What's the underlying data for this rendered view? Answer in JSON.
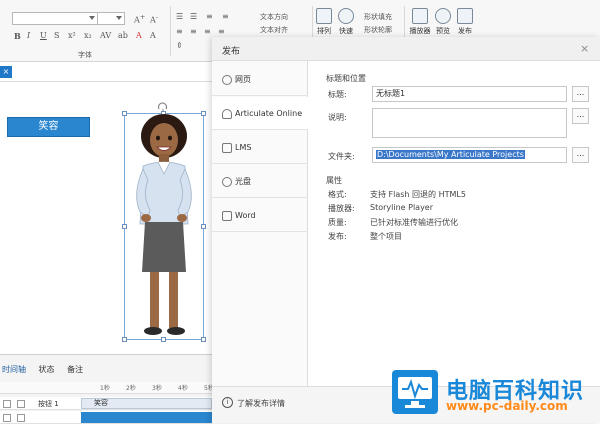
{
  "ribbon": {
    "font_group_label": "字体",
    "text_direction": "文本方向",
    "text_align": "文本对齐",
    "buttons": {
      "arrange": "排列",
      "quick_styles": "快速",
      "shape_fill": "形状填充",
      "shape_outline": "形状轮廓",
      "preview": "预览",
      "publish": "发布",
      "player": "播放器"
    }
  },
  "editor": {
    "tab_close": "×",
    "slide_button_label": "笑容",
    "timeline_tabs": [
      "时间轴",
      "状态",
      "备注"
    ],
    "ruler_marks": [
      "1秒",
      "2秒",
      "3秒",
      "4秒",
      "5秒"
    ],
    "timeline_rows": [
      {
        "name": "按钮 1",
        "clip": "笑容"
      },
      {
        "name": "",
        "clip": ""
      }
    ]
  },
  "dialog": {
    "title": "发布",
    "close": "×",
    "nav_items": [
      {
        "label": "网页",
        "icon": "globe-icon",
        "active": false
      },
      {
        "label": "Articulate Online",
        "icon": "articulate-online-icon",
        "active": true
      },
      {
        "label": "LMS",
        "icon": "lms-icon",
        "active": false
      },
      {
        "label": "光盘",
        "icon": "cd-icon",
        "active": false
      },
      {
        "label": "Word",
        "icon": "word-icon",
        "active": false
      }
    ],
    "section_title": "标题和位置",
    "title_label": "标题:",
    "title_value": "无标题1",
    "description_label": "说明:",
    "description_value": "",
    "folder_label": "文件夹:",
    "folder_value": "D:\\Documents\\My Articulate Projects",
    "browse_label": "...",
    "properties_title": "属性",
    "properties": [
      {
        "key": "格式:",
        "value": "支持 Flash 回退的 HTML5"
      },
      {
        "key": "播放器:",
        "value": "Storyline Player"
      },
      {
        "key": "质量:",
        "value": "已针对标准传输进行优化"
      },
      {
        "key": "发布:",
        "value": "整个项目"
      }
    ],
    "footer_link": "了解发布详情",
    "info_glyph": "i"
  },
  "watermark": {
    "logo_text": "电脑百科知识",
    "logo_url": "www.pc-daily.com"
  },
  "colors": {
    "accent": "#2a86cf",
    "selection": "#3a77c9",
    "logo_blue": "#1a88d8",
    "logo_orange": "#ff8a1a"
  }
}
